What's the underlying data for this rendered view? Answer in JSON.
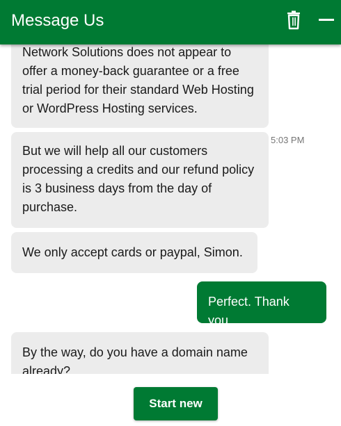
{
  "header": {
    "title": "Message Us",
    "delete_icon": "trash-icon",
    "minimize_icon": "minus-icon",
    "background_color": "#007a33"
  },
  "messages": [
    {
      "from": "agent",
      "text": "Network Solutions does not appear to offer a money-back guarantee or a free trial period for their standard Web Hosting or WordPress Hosting services."
    },
    {
      "from": "agent",
      "text": "But we will help all our customers processing a credits and our refund policy is 3 business days from the day of purchase.",
      "time": "5:03 PM"
    },
    {
      "from": "agent",
      "text": "We only accept cards or paypal, Simon."
    },
    {
      "from": "user",
      "text": "Perfect. Thank you."
    },
    {
      "from": "agent",
      "text": "By the way, do you have a domain name already?"
    }
  ],
  "footer": {
    "start_new_label": "Start new"
  },
  "colors": {
    "brand_green": "#007a33",
    "agent_bubble": "#ececec",
    "timestamp_text": "#757575"
  }
}
